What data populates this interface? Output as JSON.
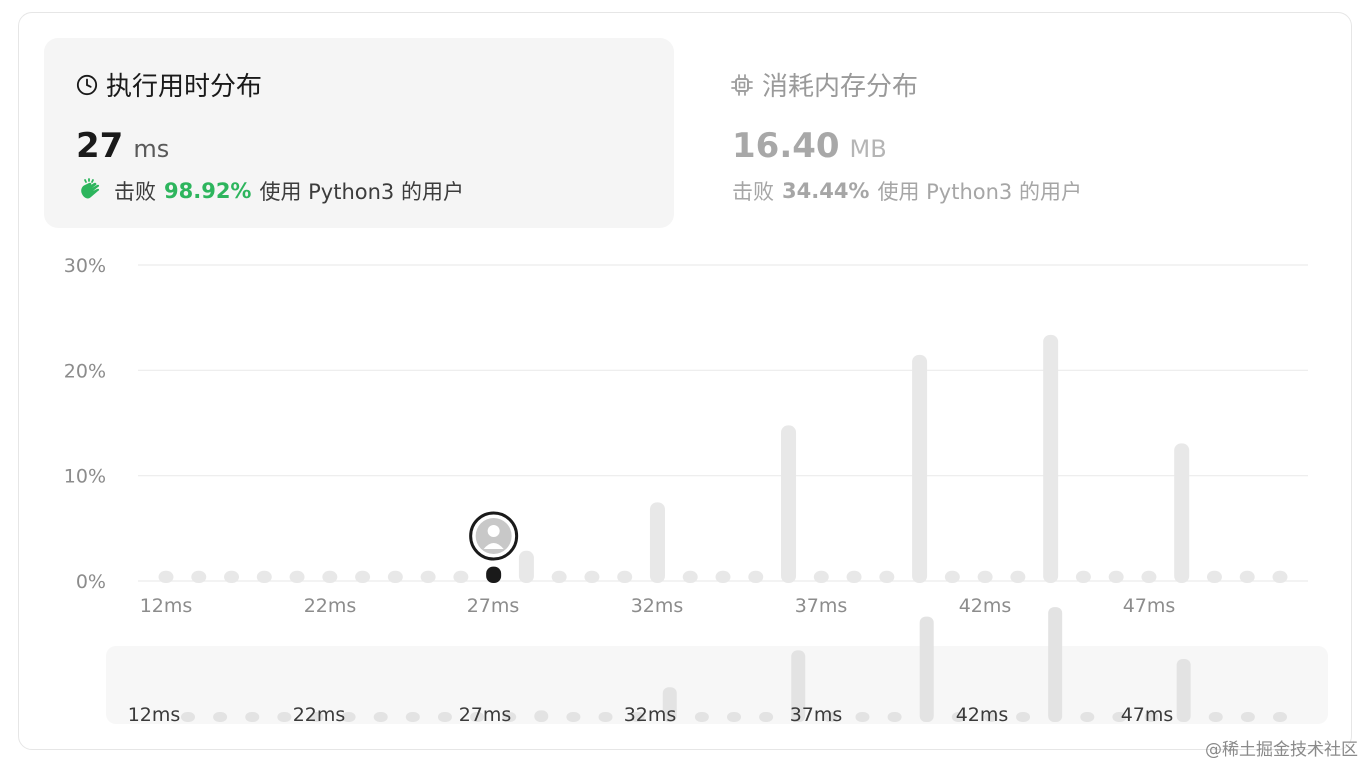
{
  "header": {
    "runtime": {
      "title": "执行用时分布",
      "value": "27",
      "unit": "ms",
      "beats_prefix": "击败",
      "beats_pct": "98.92%",
      "beats_suffix": "使用 Python3 的用户"
    },
    "memory": {
      "title": "消耗内存分布",
      "value": "16.40",
      "unit": "MB",
      "beats_prefix": "击败",
      "beats_pct": "34.44%",
      "beats_suffix": "使用 Python3 的用户"
    }
  },
  "colors": {
    "accent_green": "#2db55d",
    "bar": "#e8e8e8",
    "user_bar": "#1a1a1a",
    "grid": "#ececec"
  },
  "chart_data": {
    "type": "bar",
    "ylabel": "",
    "xlabel": "",
    "ylim": [
      0,
      30
    ],
    "yticks": [
      "0%",
      "10%",
      "20%",
      "30%"
    ],
    "x_tick_labels": [
      "12ms",
      "22ms",
      "27ms",
      "32ms",
      "37ms",
      "42ms",
      "47ms"
    ],
    "values": [
      0.4,
      0.4,
      0.4,
      0.4,
      0.4,
      0.4,
      0.4,
      0.4,
      0.4,
      0.4,
      0.4,
      2.3,
      0.4,
      0.4,
      0.4,
      6.9,
      0.4,
      0.4,
      0.4,
      14.2,
      0.4,
      0.4,
      0.4,
      20.9,
      0.4,
      0.4,
      0.4,
      22.8,
      0.4,
      0.4,
      0.4,
      12.5,
      0.4,
      0.4,
      0.4
    ],
    "user_value": "27ms",
    "user_bar_value": 0.8
  },
  "watermark": "@稀土掘金技术社区"
}
